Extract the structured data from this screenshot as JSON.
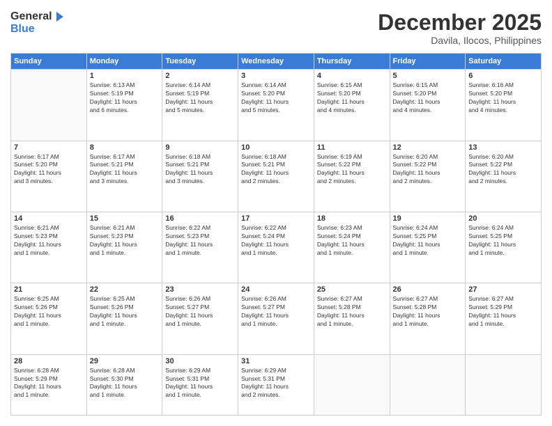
{
  "header": {
    "logo_general": "General",
    "logo_blue": "Blue",
    "month": "December 2025",
    "location": "Davila, Ilocos, Philippines"
  },
  "weekdays": [
    "Sunday",
    "Monday",
    "Tuesday",
    "Wednesday",
    "Thursday",
    "Friday",
    "Saturday"
  ],
  "weeks": [
    [
      {
        "day": "",
        "info": ""
      },
      {
        "day": "1",
        "info": "Sunrise: 6:13 AM\nSunset: 5:19 PM\nDaylight: 11 hours\nand 6 minutes."
      },
      {
        "day": "2",
        "info": "Sunrise: 6:14 AM\nSunset: 5:19 PM\nDaylight: 11 hours\nand 5 minutes."
      },
      {
        "day": "3",
        "info": "Sunrise: 6:14 AM\nSunset: 5:20 PM\nDaylight: 11 hours\nand 5 minutes."
      },
      {
        "day": "4",
        "info": "Sunrise: 6:15 AM\nSunset: 5:20 PM\nDaylight: 11 hours\nand 4 minutes."
      },
      {
        "day": "5",
        "info": "Sunrise: 6:15 AM\nSunset: 5:20 PM\nDaylight: 11 hours\nand 4 minutes."
      },
      {
        "day": "6",
        "info": "Sunrise: 6:16 AM\nSunset: 5:20 PM\nDaylight: 11 hours\nand 4 minutes."
      }
    ],
    [
      {
        "day": "7",
        "info": "Sunrise: 6:17 AM\nSunset: 5:20 PM\nDaylight: 11 hours\nand 3 minutes."
      },
      {
        "day": "8",
        "info": "Sunrise: 6:17 AM\nSunset: 5:21 PM\nDaylight: 11 hours\nand 3 minutes."
      },
      {
        "day": "9",
        "info": "Sunrise: 6:18 AM\nSunset: 5:21 PM\nDaylight: 11 hours\nand 3 minutes."
      },
      {
        "day": "10",
        "info": "Sunrise: 6:18 AM\nSunset: 5:21 PM\nDaylight: 11 hours\nand 2 minutes."
      },
      {
        "day": "11",
        "info": "Sunrise: 6:19 AM\nSunset: 5:22 PM\nDaylight: 11 hours\nand 2 minutes."
      },
      {
        "day": "12",
        "info": "Sunrise: 6:20 AM\nSunset: 5:22 PM\nDaylight: 11 hours\nand 2 minutes."
      },
      {
        "day": "13",
        "info": "Sunrise: 6:20 AM\nSunset: 5:22 PM\nDaylight: 11 hours\nand 2 minutes."
      }
    ],
    [
      {
        "day": "14",
        "info": "Sunrise: 6:21 AM\nSunset: 5:23 PM\nDaylight: 11 hours\nand 1 minute."
      },
      {
        "day": "15",
        "info": "Sunrise: 6:21 AM\nSunset: 5:23 PM\nDaylight: 11 hours\nand 1 minute."
      },
      {
        "day": "16",
        "info": "Sunrise: 6:22 AM\nSunset: 5:23 PM\nDaylight: 11 hours\nand 1 minute."
      },
      {
        "day": "17",
        "info": "Sunrise: 6:22 AM\nSunset: 5:24 PM\nDaylight: 11 hours\nand 1 minute."
      },
      {
        "day": "18",
        "info": "Sunrise: 6:23 AM\nSunset: 5:24 PM\nDaylight: 11 hours\nand 1 minute."
      },
      {
        "day": "19",
        "info": "Sunrise: 6:24 AM\nSunset: 5:25 PM\nDaylight: 11 hours\nand 1 minute."
      },
      {
        "day": "20",
        "info": "Sunrise: 6:24 AM\nSunset: 5:25 PM\nDaylight: 11 hours\nand 1 minute."
      }
    ],
    [
      {
        "day": "21",
        "info": "Sunrise: 6:25 AM\nSunset: 5:26 PM\nDaylight: 11 hours\nand 1 minute."
      },
      {
        "day": "22",
        "info": "Sunrise: 6:25 AM\nSunset: 5:26 PM\nDaylight: 11 hours\nand 1 minute."
      },
      {
        "day": "23",
        "info": "Sunrise: 6:26 AM\nSunset: 5:27 PM\nDaylight: 11 hours\nand 1 minute."
      },
      {
        "day": "24",
        "info": "Sunrise: 6:26 AM\nSunset: 5:27 PM\nDaylight: 11 hours\nand 1 minute."
      },
      {
        "day": "25",
        "info": "Sunrise: 6:27 AM\nSunset: 5:28 PM\nDaylight: 11 hours\nand 1 minute."
      },
      {
        "day": "26",
        "info": "Sunrise: 6:27 AM\nSunset: 5:28 PM\nDaylight: 11 hours\nand 1 minute."
      },
      {
        "day": "27",
        "info": "Sunrise: 6:27 AM\nSunset: 5:29 PM\nDaylight: 11 hours\nand 1 minute."
      }
    ],
    [
      {
        "day": "28",
        "info": "Sunrise: 6:28 AM\nSunset: 5:29 PM\nDaylight: 11 hours\nand 1 minute."
      },
      {
        "day": "29",
        "info": "Sunrise: 6:28 AM\nSunset: 5:30 PM\nDaylight: 11 hours\nand 1 minute."
      },
      {
        "day": "30",
        "info": "Sunrise: 6:29 AM\nSunset: 5:31 PM\nDaylight: 11 hours\nand 1 minute."
      },
      {
        "day": "31",
        "info": "Sunrise: 6:29 AM\nSunset: 5:31 PM\nDaylight: 11 hours\nand 2 minutes."
      },
      {
        "day": "",
        "info": ""
      },
      {
        "day": "",
        "info": ""
      },
      {
        "day": "",
        "info": ""
      }
    ]
  ]
}
